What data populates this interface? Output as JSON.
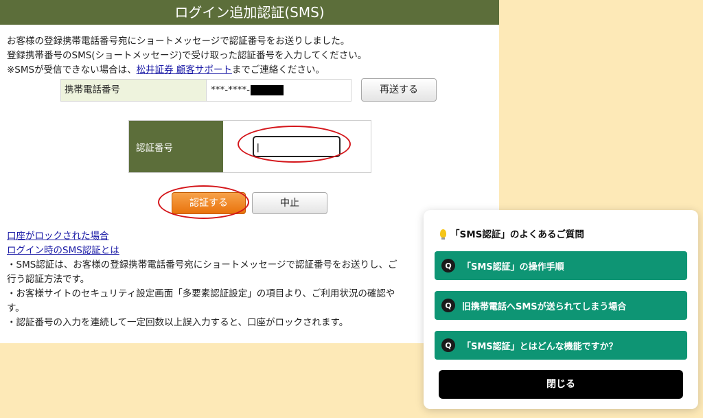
{
  "header": {
    "title": "ログイン追加認証(SMS)"
  },
  "intro": {
    "line1": "お客様の登録携帯電話番号宛にショートメッセージで認証番号をお送りしました。",
    "line2": "登録携帯番号のSMS(ショートメッセージ)で受け取った認証番号を入力してください。",
    "line3_prefix": "※SMSが受信できない場合は、",
    "line3_link": "松井証券 顧客サポート",
    "line3_suffix": "までご連絡ください。"
  },
  "phone": {
    "label": "携帯電話番号",
    "value": "***-****-",
    "resend_label": "再送する"
  },
  "code": {
    "label": "認証番号",
    "input_value": "|"
  },
  "actions": {
    "submit_label": "認証する",
    "cancel_label": "中止"
  },
  "lower": {
    "link_locked": "口座がロックされた場合",
    "link_about": "ログイン時のSMS認証とは",
    "para1": "・SMS認証は、お客様の登録携帯電話番号宛にショートメッセージで認証番号をお送りし、ご",
    "para1b": "行う認証方法です。",
    "para2": "・お客様サイトのセキュリティ設定画面「多要素認証設定」の項目より、ご利用状況の確認や",
    "para2b": "す。",
    "para3": "・認証番号の入力を連続して一定回数以上誤入力すると、口座がロックされます。"
  },
  "faq": {
    "title": "「SMS認証」のよくあるご質問",
    "q_badge": "Q",
    "items": [
      {
        "label": "「SMS認証」の操作手順"
      },
      {
        "label": "旧携帯電話へSMSが送られてしまう場合"
      },
      {
        "label": "「SMS認証」とはどんな機能ですか？"
      }
    ],
    "close_label": "閉じる"
  },
  "colors": {
    "header_bg": "#5c6e3a",
    "page_bg": "#fde9b7",
    "faq_item_bg": "#0e9574",
    "submit_bg": "#e9730c",
    "annotation": "#d4161b"
  }
}
